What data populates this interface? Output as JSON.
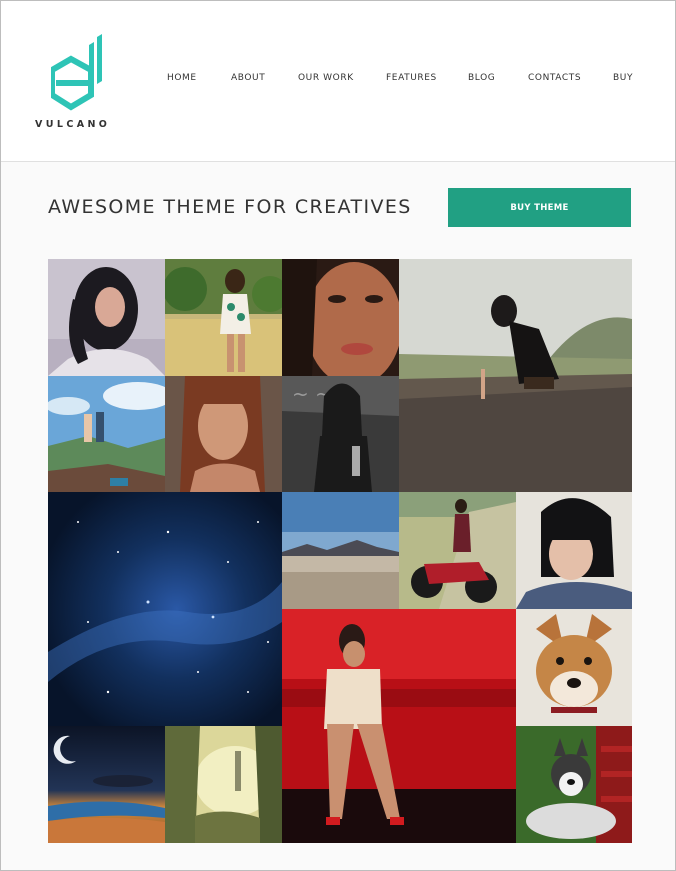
{
  "brand": {
    "name": "VULCANO",
    "accent": "#2ec4b6",
    "logo_icon": "vulcano-logo-icon"
  },
  "nav": {
    "items": [
      {
        "label": "HOME"
      },
      {
        "label": "ABOUT"
      },
      {
        "label": "OUR WORK"
      },
      {
        "label": "FEATURES"
      },
      {
        "label": "BLOG"
      },
      {
        "label": "CONTACTS"
      },
      {
        "label": "BUY"
      }
    ]
  },
  "hero": {
    "title": "AWESOME THEME FOR CREATIVES",
    "button_label": "BUY THEME",
    "button_color": "#21a083"
  },
  "gallery": {
    "tiles": [
      {
        "subject": "woman with dark curly hair"
      },
      {
        "subject": "woman in field"
      },
      {
        "subject": "close-up face of woman"
      },
      {
        "subject": "woman kneeling on road"
      },
      {
        "subject": "hikers on mountain top"
      },
      {
        "subject": "woman with red hair portrait"
      },
      {
        "subject": "black and white woman portrait"
      },
      {
        "subject": "starry night sky"
      },
      {
        "subject": "desert landscape"
      },
      {
        "subject": "woman with motorcycle"
      },
      {
        "subject": "woman with black bob haircut"
      },
      {
        "subject": "woman on red sofa"
      },
      {
        "subject": "shiba dog portrait"
      },
      {
        "subject": "moon over beach"
      },
      {
        "subject": "fantasy cliffs with tower"
      },
      {
        "subject": "husky on bench"
      }
    ]
  }
}
